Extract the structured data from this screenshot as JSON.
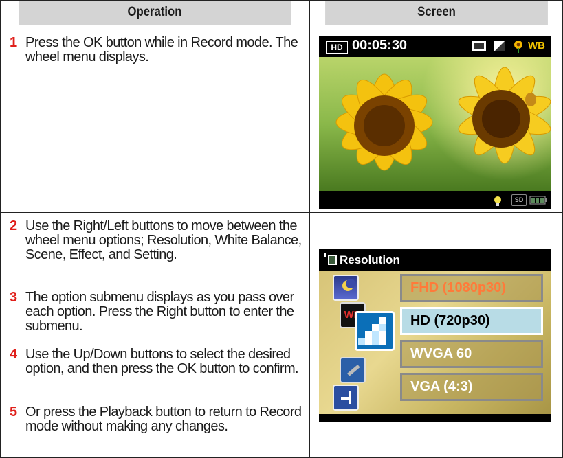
{
  "header": {
    "col1": "Operation",
    "col2": "Screen"
  },
  "rows": [
    {
      "steps": [
        {
          "num": "1",
          "text": "Press the OK button while in Record mode. The wheel menu displays."
        }
      ]
    },
    {
      "steps": [
        {
          "num": "2",
          "text": "Use the Right/Left buttons to move between the wheel menu options; Resolution, White Balance, Scene, Effect, and Setting."
        },
        {
          "num": "3",
          "text": "The option submenu displays as you pass over each option. Press the Right button to enter the submenu."
        },
        {
          "num": "4",
          "text": "Use the Up/Down buttons to select the desired option, and then press the OK button to confirm."
        },
        {
          "num": "5",
          "text": "Or press the Playback button to return to Record mode without making any changes."
        }
      ]
    }
  ],
  "screen1": {
    "hd_badge": "HD",
    "record_time": "00:05:30",
    "wb_label": "WB",
    "sd_label": "SD",
    "icons": [
      "resolution-icon",
      "exposure-icon",
      "scene-flower-icon",
      "white-balance-icon",
      "light-icon",
      "sd-card-icon",
      "battery-icon"
    ]
  },
  "screen2": {
    "title": "Resolution",
    "options": [
      "FHD (1080p30)",
      "HD (720p30)",
      "WVGA 60",
      "VGA (4:3)"
    ],
    "selected": "HD (720p30)",
    "menu_icons": [
      "scene-night-icon",
      "white-balance-icon",
      "resolution-icon",
      "setting-icon",
      "effect-icon"
    ]
  },
  "colors": {
    "step_number": "#e0201b",
    "header_bg": "#d4d4d4",
    "selected_option": "#b8dce6"
  }
}
